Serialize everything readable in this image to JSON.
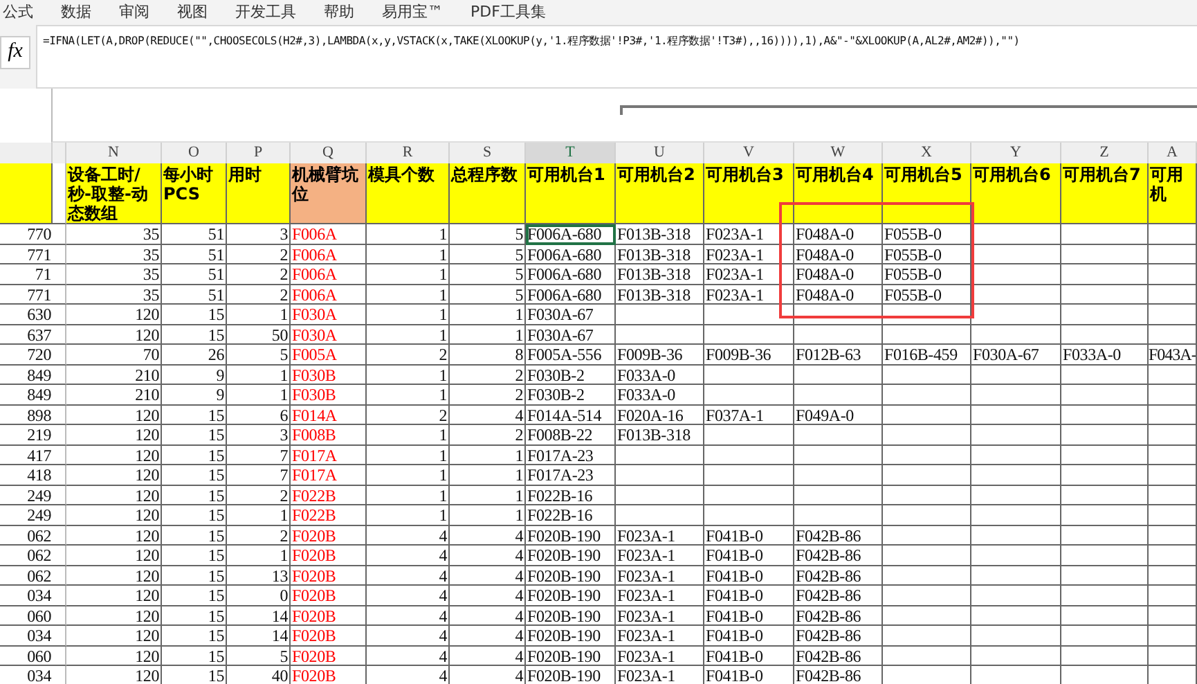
{
  "menu_bar": {
    "items": [
      "公式",
      "数据",
      "审阅",
      "视图",
      "开发工具",
      "帮助",
      "易用宝™",
      "PDF工具集"
    ]
  },
  "formula_bar": {
    "icon": "fx",
    "formula": "=IFNA(LET(A,DROP(REDUCE(\"\",CHOOSECOLS(H2#,3),LAMBDA(x,y,VSTACK(x,TAKE(XLOOKUP(y,'1.程序数据'!P3#,'1.程序数据'!T3#),,16)))),1),A&\"-\"&XLOOKUP(A,AL2#,AM2#)),\"\")"
  },
  "sheet": {
    "columns": [
      {
        "kind": "number",
        "selected": false
      },
      {
        "letter": "N",
        "header": "设备工时/秒-取整-动态数组",
        "color": "#ffff00",
        "kind": "number",
        "selected": false
      },
      {
        "letter": "O",
        "header": "每小时PCS",
        "color": "#ffff00",
        "kind": "number",
        "selected": false
      },
      {
        "letter": "P",
        "header": "用时",
        "color": "#ffff00",
        "kind": "number",
        "selected": false
      },
      {
        "letter": "Q",
        "header": "机械臂坑位",
        "color": "#f4b183",
        "kind": "red-text",
        "selected": false
      },
      {
        "letter": "R",
        "header": "模具个数",
        "color": "#ffff00",
        "kind": "number",
        "selected": false
      },
      {
        "letter": "S",
        "header": "总程序数",
        "color": "#ffff00",
        "kind": "number",
        "selected": false
      },
      {
        "letter": "T",
        "header": "可用机台1",
        "color": "#ffff00",
        "kind": "text",
        "selected": true
      },
      {
        "letter": "U",
        "header": "可用机台2",
        "color": "#ffff00",
        "kind": "text",
        "selected": false
      },
      {
        "letter": "V",
        "header": "可用机台3",
        "color": "#ffff00",
        "kind": "text",
        "selected": false
      },
      {
        "letter": "W",
        "header": "可用机台4",
        "color": "#ffff00",
        "kind": "text",
        "selected": false
      },
      {
        "letter": "X",
        "header": "可用机台5",
        "color": "#ffff00",
        "kind": "text",
        "selected": false
      },
      {
        "letter": "Y",
        "header": "可用机台6",
        "color": "#ffff00",
        "kind": "text",
        "selected": false
      },
      {
        "letter": "Z",
        "header": "可用机台7",
        "color": "#ffff00",
        "kind": "text",
        "selected": false
      },
      {
        "letter": "A",
        "header": "可用机",
        "color": "#ffff00",
        "kind": "text",
        "selected": false
      }
    ],
    "rows": [
      {
        "selected": true,
        "cells": [
          "770",
          "35",
          "51",
          "3",
          "F006A",
          "1",
          "5",
          "F006A-680",
          "F013B-318",
          "F023A-1",
          "F048A-0",
          "F055B-0"
        ]
      },
      {
        "selected": false,
        "cells": [
          "771",
          "35",
          "51",
          "2",
          "F006A",
          "1",
          "5",
          "F006A-680",
          "F013B-318",
          "F023A-1",
          "F048A-0",
          "F055B-0"
        ]
      },
      {
        "selected": false,
        "cells": [
          "71",
          "35",
          "51",
          "2",
          "F006A",
          "1",
          "5",
          "F006A-680",
          "F013B-318",
          "F023A-1",
          "F048A-0",
          "F055B-0"
        ]
      },
      {
        "selected": false,
        "cells": [
          "771",
          "35",
          "51",
          "2",
          "F006A",
          "1",
          "5",
          "F006A-680",
          "F013B-318",
          "F023A-1",
          "F048A-0",
          "F055B-0"
        ]
      },
      {
        "selected": false,
        "cells": [
          "630",
          "120",
          "15",
          "1",
          "F030A",
          "1",
          "1",
          "F030A-67"
        ]
      },
      {
        "selected": false,
        "cells": [
          "637",
          "120",
          "15",
          "50",
          "F030A",
          "1",
          "1",
          "F030A-67"
        ]
      },
      {
        "selected": false,
        "cells": [
          "720",
          "70",
          "26",
          "5",
          "F005A",
          "2",
          "8",
          "F005A-556",
          "F009B-36",
          "F009B-36",
          "F012B-63",
          "F016B-459",
          "F030A-67",
          "F033A-0",
          "F043A-"
        ]
      },
      {
        "selected": false,
        "cells": [
          "849",
          "210",
          "9",
          "1",
          "F030B",
          "1",
          "2",
          "F030B-2",
          "F033A-0"
        ]
      },
      {
        "selected": false,
        "cells": [
          "849",
          "210",
          "9",
          "1",
          "F030B",
          "1",
          "2",
          "F030B-2",
          "F033A-0"
        ]
      },
      {
        "selected": false,
        "cells": [
          "898",
          "120",
          "15",
          "6",
          "F014A",
          "2",
          "4",
          "F014A-514",
          "F020A-16",
          "F037A-1",
          "F049A-0"
        ]
      },
      {
        "selected": false,
        "cells": [
          "219",
          "120",
          "15",
          "3",
          "F008B",
          "1",
          "2",
          "F008B-22",
          "F013B-318"
        ]
      },
      {
        "selected": false,
        "cells": [
          "417",
          "120",
          "15",
          "7",
          "F017A",
          "1",
          "1",
          "F017A-23"
        ]
      },
      {
        "selected": false,
        "cells": [
          "418",
          "120",
          "15",
          "7",
          "F017A",
          "1",
          "1",
          "F017A-23"
        ]
      },
      {
        "selected": false,
        "cells": [
          "249",
          "120",
          "15",
          "2",
          "F022B",
          "1",
          "1",
          "F022B-16"
        ]
      },
      {
        "selected": false,
        "cells": [
          "249",
          "120",
          "15",
          "1",
          "F022B",
          "1",
          "1",
          "F022B-16"
        ]
      },
      {
        "selected": false,
        "cells": [
          "062",
          "120",
          "15",
          "2",
          "F020B",
          "4",
          "4",
          "F020B-190",
          "F023A-1",
          "F041B-0",
          "F042B-86"
        ]
      },
      {
        "selected": false,
        "cells": [
          "062",
          "120",
          "15",
          "1",
          "F020B",
          "4",
          "4",
          "F020B-190",
          "F023A-1",
          "F041B-0",
          "F042B-86"
        ]
      },
      {
        "selected": false,
        "cells": [
          "062",
          "120",
          "15",
          "13",
          "F020B",
          "4",
          "4",
          "F020B-190",
          "F023A-1",
          "F041B-0",
          "F042B-86"
        ]
      },
      {
        "selected": false,
        "cells": [
          "034",
          "120",
          "15",
          "0",
          "F020B",
          "4",
          "4",
          "F020B-190",
          "F023A-1",
          "F041B-0",
          "F042B-86"
        ]
      },
      {
        "selected": false,
        "cells": [
          "060",
          "120",
          "15",
          "14",
          "F020B",
          "4",
          "4",
          "F020B-190",
          "F023A-1",
          "F041B-0",
          "F042B-86"
        ]
      },
      {
        "selected": false,
        "cells": [
          "034",
          "120",
          "15",
          "14",
          "F020B",
          "4",
          "4",
          "F020B-190",
          "F023A-1",
          "F041B-0",
          "F042B-86"
        ]
      },
      {
        "selected": false,
        "cells": [
          "060",
          "120",
          "15",
          "5",
          "F020B",
          "4",
          "4",
          "F020B-190",
          "F023A-1",
          "F041B-0",
          "F042B-86"
        ]
      },
      {
        "selected": false,
        "cells": [
          "034",
          "120",
          "15",
          "40",
          "F020B",
          "4",
          "4",
          "F020B-190",
          "F023A-1",
          "F041B-0",
          "F042B-86"
        ]
      }
    ]
  }
}
